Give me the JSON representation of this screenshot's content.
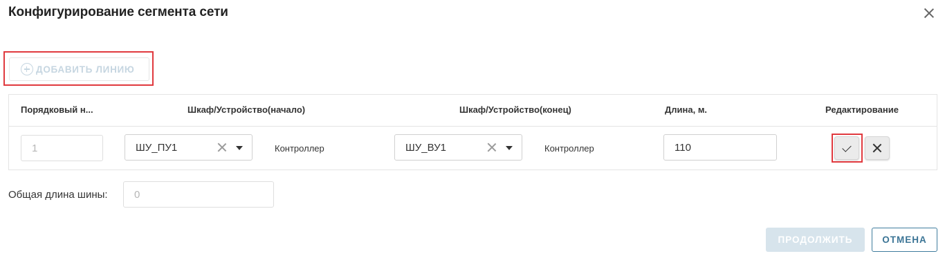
{
  "dialog": {
    "title": "Конфигурирование сегмента сети"
  },
  "toolbar": {
    "add_line_label": "ДОБАВИТЬ ЛИНИЮ",
    "add_line_icon": "plus-circle-icon"
  },
  "grid": {
    "columns": [
      "Порядковый н...",
      "Шкаф/Устройство(начало)",
      "Шкаф/Устройство(конец)",
      "Длина, м.",
      "Редактирование"
    ],
    "rows": [
      {
        "order": "1",
        "start_device": "ШУ_ПУ1",
        "start_type": "Контроллер",
        "end_device": "ШУ_ВУ1",
        "end_type": "Контроллер",
        "length": "110"
      }
    ]
  },
  "total": {
    "label": "Общая длина шины:",
    "value": "0"
  },
  "footer": {
    "continue_label": "ПРОДОЛЖИТЬ",
    "cancel_label": "ОТМЕНА"
  },
  "colors": {
    "highlight": "#e0393e",
    "accent": "#3c7596",
    "disabled_button_bg": "#d7e4ec"
  }
}
